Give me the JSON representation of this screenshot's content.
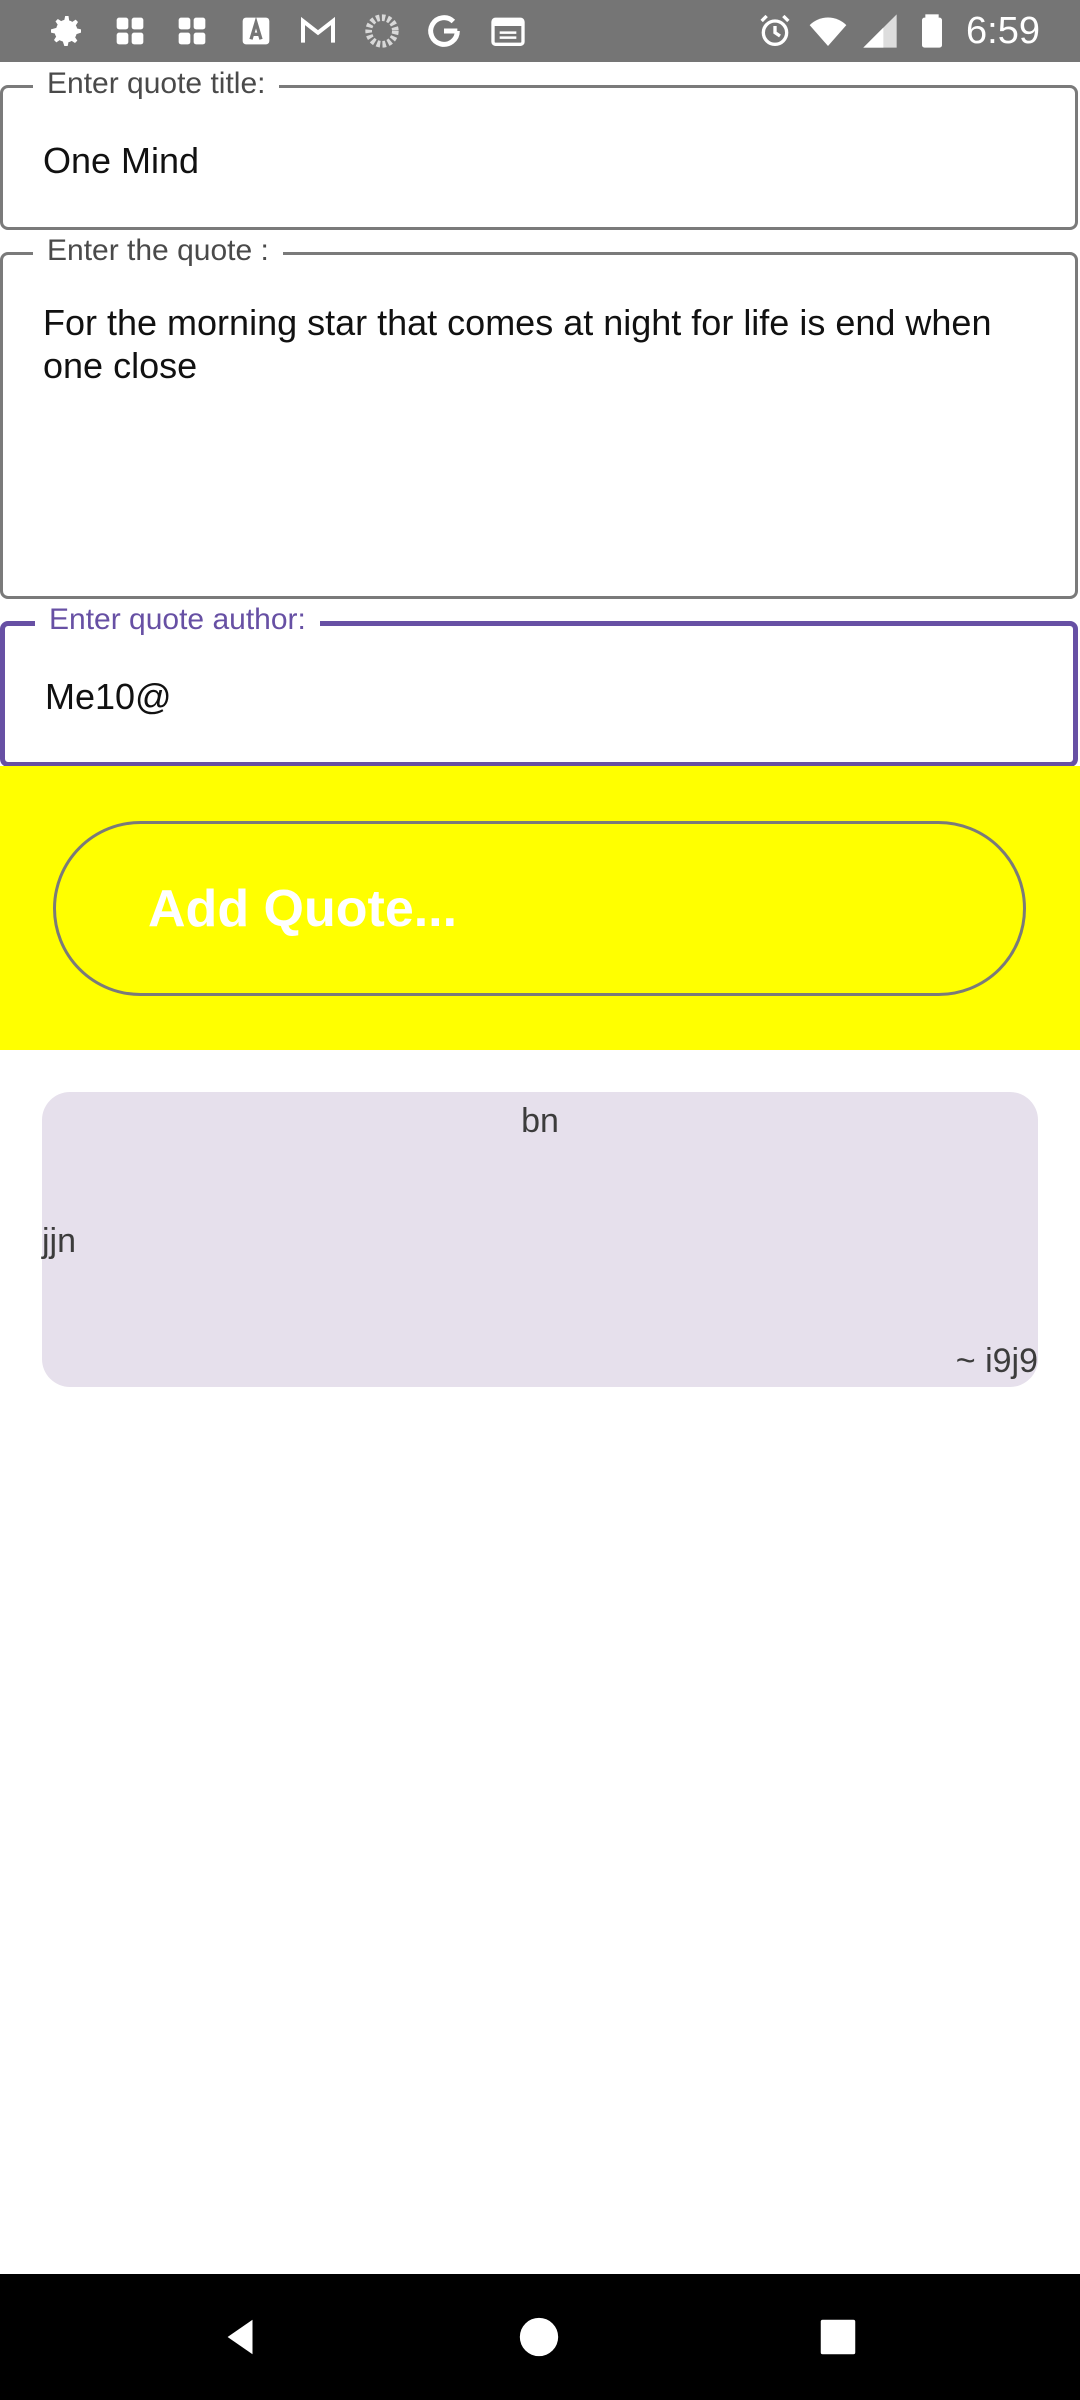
{
  "status_bar": {
    "time": "6:59",
    "left_icons": [
      "gear-icon",
      "grid-app-icon",
      "grid-app-icon-2",
      "font-a-icon",
      "gmail-icon",
      "loading-circle-icon",
      "google-icon",
      "calendar-icon"
    ],
    "right_icons": [
      "alarm-icon",
      "wifi-icon",
      "signal-icon",
      "battery-icon"
    ]
  },
  "form": {
    "title_label": "Enter quote title:",
    "title_value": "One Mind",
    "quote_label": "Enter the quote :",
    "quote_value": "For the morning star that comes at night for life is end when one close",
    "author_label": "Enter quote author:",
    "author_value": "Me10@"
  },
  "add_button": {
    "label": "Add Quote..."
  },
  "quote_card": {
    "title": "bn",
    "body": "jjn",
    "author": "~ i9j9"
  },
  "colors": {
    "accent": "#6750a4",
    "yellow": "#ffff00",
    "card_bg": "#e6e0ec",
    "status_bar": "#757575"
  }
}
